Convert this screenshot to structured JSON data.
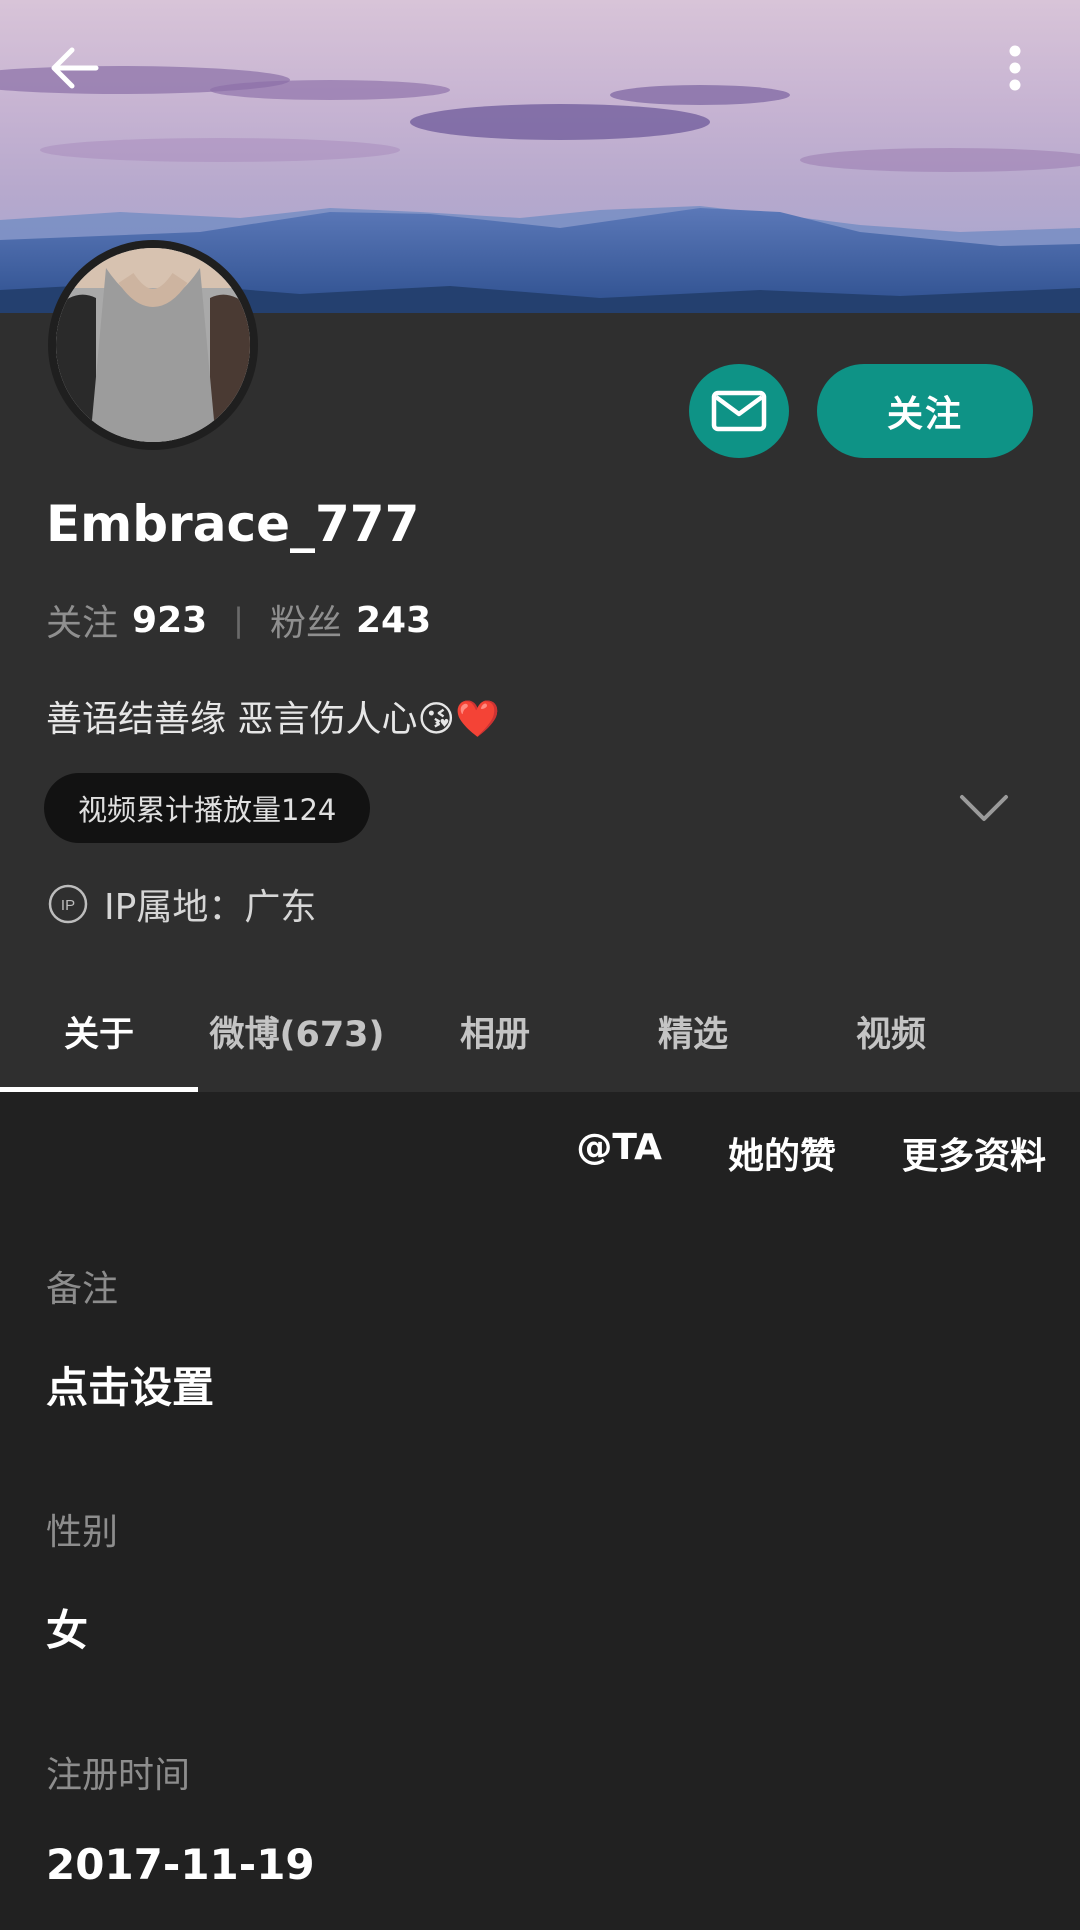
{
  "profile": {
    "username": "Embrace_777",
    "follow_button": "关注",
    "stats": {
      "following_label": "关注",
      "following_count": "923",
      "separator": "|",
      "fans_label": "粉丝",
      "fans_count": "243"
    },
    "bio": "善语结善缘  恶言伤人心😘❤️",
    "badge": "视频累计播放量124",
    "ip_location": "IP属地：广东"
  },
  "tabs": [
    {
      "label": "关于",
      "active": true
    },
    {
      "label": "微博(673)",
      "active": false
    },
    {
      "label": "相册",
      "active": false
    },
    {
      "label": "精选",
      "active": false
    },
    {
      "label": "视频",
      "active": false
    }
  ],
  "sublinks": {
    "mention": "@TA",
    "likes": "她的赞",
    "more_info": "更多资料"
  },
  "fields": {
    "remark_label": "备注",
    "remark_value": "点击设置",
    "gender_label": "性别",
    "gender_value": "女",
    "register_label": "注册时间",
    "register_value": "2017-11-19"
  },
  "icons": {
    "back": "arrow-left-icon",
    "more": "more-vertical-icon",
    "message": "mail-icon",
    "expand": "chevron-down-icon",
    "ip": "ip-icon"
  },
  "colors": {
    "accent": "#0e9386",
    "header_bg": "#2f2f2f",
    "page_bg": "#212121",
    "badge_bg": "#121212"
  }
}
